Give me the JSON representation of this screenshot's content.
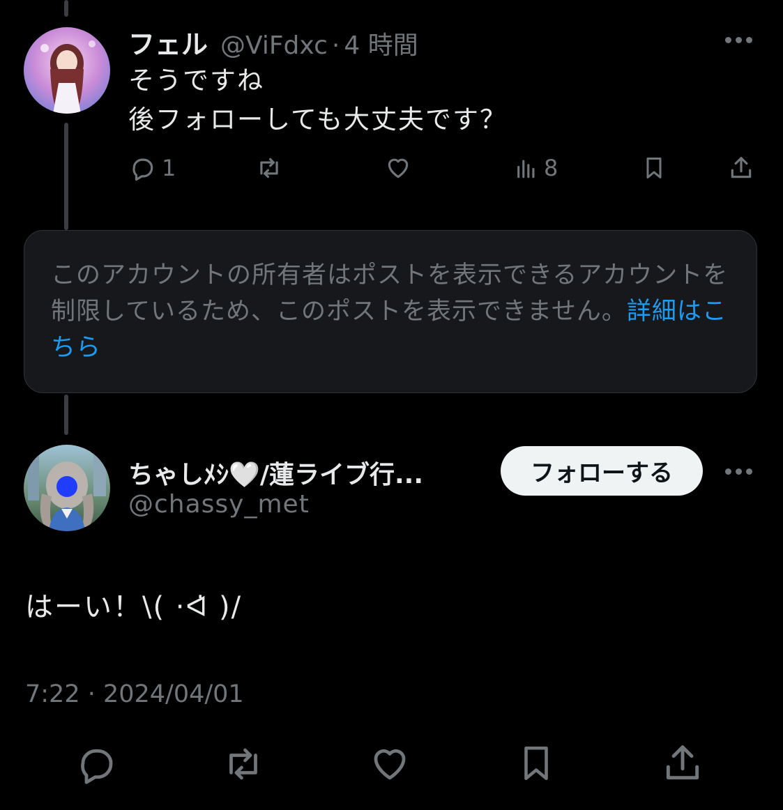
{
  "thread": {
    "parent_post": {
      "display_name": "フェル",
      "handle": "@ViFdxc",
      "separator": "·",
      "time_ago": "4 時間",
      "text_line1": "そうですね",
      "text_line2": "後フォローしても大丈夫です？",
      "reply_count": "1",
      "views_count": "8"
    },
    "notice": {
      "text": "このアカウントの所有者はポストを表示できるアカウントを制限しているため、このポストを表示できません。",
      "link_text": "詳細はこちら"
    },
    "main_post": {
      "display_name": "ちゃしﾒｼ🤍/蓮ライブ行...",
      "handle": "@chassy_met",
      "follow_label": "フォローする",
      "text": "はーい！\\( ·ᐊ̇ )/",
      "timestamp": "7:22 · 2024/04/01"
    }
  },
  "colors": {
    "background": "#000000",
    "primary_text": "#e7e9ea",
    "secondary_text": "#71767b",
    "link": "#1d9bf0",
    "notice_bg": "#16181c",
    "follow_bg": "#eff3f4"
  },
  "icons": {
    "reply": "reply-icon",
    "repost": "repost-icon",
    "like": "like-icon",
    "views": "views-icon",
    "bookmark": "bookmark-icon",
    "share": "share-icon",
    "more": "more-icon"
  }
}
